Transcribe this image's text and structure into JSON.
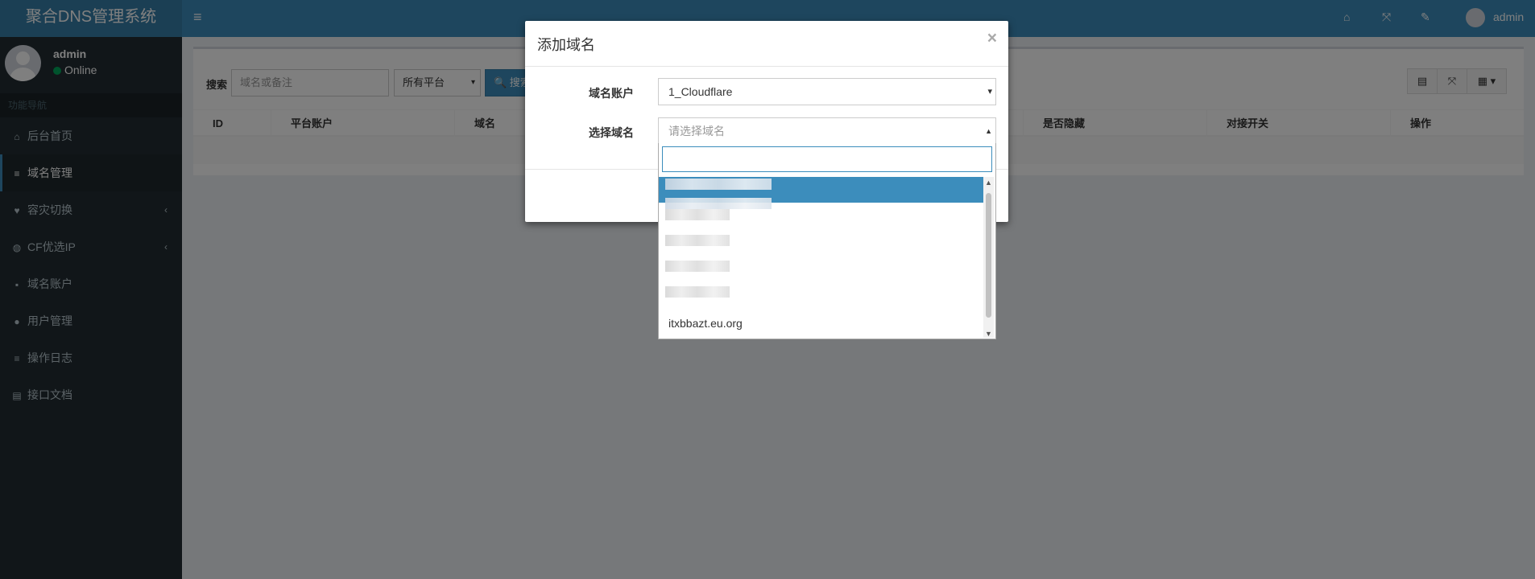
{
  "app": {
    "title": "聚合DNS管理系统"
  },
  "user": {
    "name": "admin",
    "status": "Online"
  },
  "sidebar": {
    "header": "功能导航",
    "items": [
      {
        "label": "后台首页",
        "icon": "home-icon",
        "glyph": "⌂"
      },
      {
        "label": "域名管理",
        "icon": "list-icon",
        "glyph": "≡"
      },
      {
        "label": "容灾切换",
        "icon": "heartbeat-icon",
        "glyph": "♥",
        "arrow": "‹"
      },
      {
        "label": "CF优选IP",
        "icon": "globe-icon",
        "glyph": "◍",
        "arrow": "‹"
      },
      {
        "label": "域名账户",
        "icon": "lock-icon",
        "glyph": "▪"
      },
      {
        "label": "用户管理",
        "icon": "user-icon",
        "glyph": "●"
      },
      {
        "label": "操作日志",
        "icon": "log-list-icon",
        "glyph": "≡"
      },
      {
        "label": "接口文档",
        "icon": "book-icon",
        "glyph": "▤"
      }
    ]
  },
  "header": {
    "menu_glyph": "≡",
    "home_glyph": "⌂",
    "fullscreen_glyph": "⤧",
    "wrench_glyph": "✎",
    "user_name": "admin"
  },
  "toolbar": {
    "search_label": "搜索",
    "search_placeholder": "域名或备注",
    "platform_value": "所有平台",
    "search_button": "🔍 搜索",
    "table_glyph": "▤",
    "fullscreen_glyph": "⤧",
    "columns_glyph": "▦ ▾"
  },
  "table": {
    "columns": [
      "ID",
      "平台账户",
      "域名",
      "是否隐藏",
      "对接开关",
      "操作"
    ]
  },
  "modal": {
    "title": "添加域名",
    "close": "×",
    "account_label": "域名账户",
    "account_value": "1_Cloudflare",
    "domain_label": "选择域名",
    "domain_placeholder": "请选择域名"
  },
  "dropdown": {
    "search_value": "",
    "visible_option": "itxbbazt.eu.org",
    "scroll_up": "▲",
    "scroll_down": "▼"
  },
  "colors": {
    "sidebar_bg": "#222d32",
    "header_bg": "#3c8dbc",
    "highlight": "#3c8dbc"
  }
}
